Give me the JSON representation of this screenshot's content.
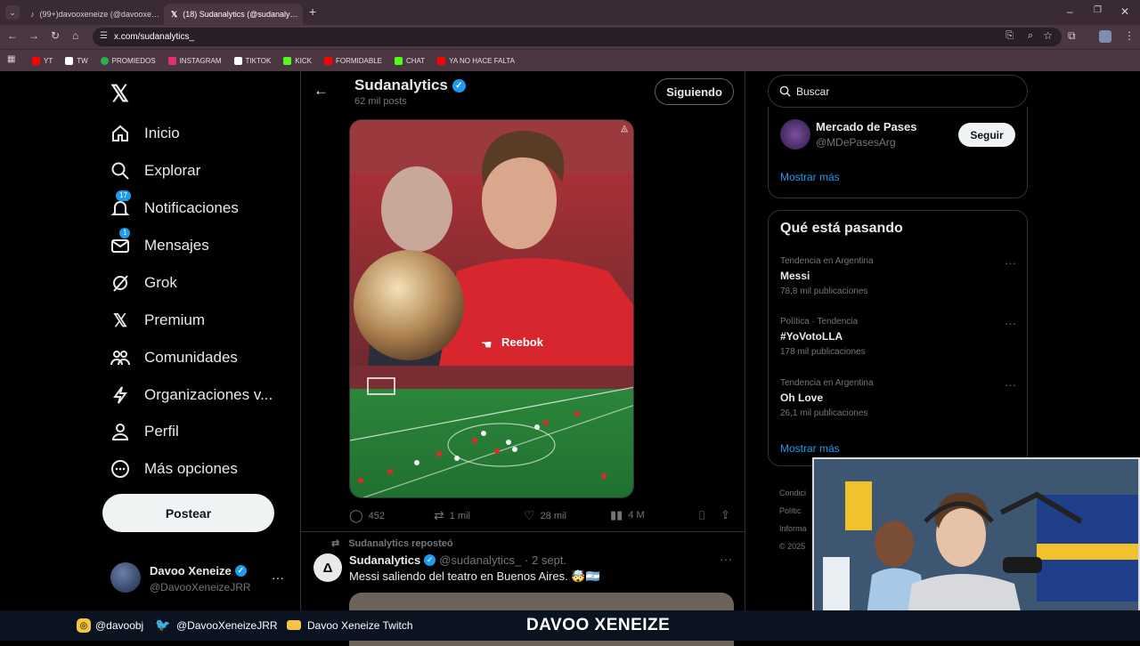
{
  "browser": {
    "tabs": [
      {
        "title": "(99+)davooxeneize (@davooxe…",
        "active": false
      },
      {
        "title": "(18) Sudanalytics (@sudanaly…",
        "active": true
      }
    ],
    "url": "x.com/sudanalytics_",
    "bookmarks": [
      {
        "label": "YT",
        "color": "#ff0000"
      },
      {
        "label": "TW",
        "color": "#ffffff"
      },
      {
        "label": "PROMIEDOS",
        "color": "#2bb24c"
      },
      {
        "label": "INSTAGRAM",
        "color": "#e1306c"
      },
      {
        "label": "TIKTOK",
        "color": "#ffffff"
      },
      {
        "label": "KICK",
        "color": "#53fc18"
      },
      {
        "label": "FORMIDABLE",
        "color": "#ff0000"
      },
      {
        "label": "CHAT",
        "color": "#53fc18"
      },
      {
        "label": "YA NO HACE FALTA",
        "color": "#ff0000"
      }
    ]
  },
  "nav": {
    "items": [
      {
        "label": "Inicio",
        "icon": "home-icon",
        "badge": ""
      },
      {
        "label": "Explorar",
        "icon": "search-icon",
        "badge": ""
      },
      {
        "label": "Notificaciones",
        "icon": "bell-icon",
        "badge": "17"
      },
      {
        "label": "Mensajes",
        "icon": "mail-icon",
        "badge": "1"
      },
      {
        "label": "Grok",
        "icon": "grok-icon",
        "badge": ""
      },
      {
        "label": "Premium",
        "icon": "x-icon",
        "badge": ""
      },
      {
        "label": "Comunidades",
        "icon": "people-icon",
        "badge": ""
      },
      {
        "label": "Organizaciones v...",
        "icon": "bolt-icon",
        "badge": ""
      },
      {
        "label": "Perfil",
        "icon": "person-icon",
        "badge": ""
      },
      {
        "label": "Más opciones",
        "icon": "more-icon",
        "badge": ""
      }
    ],
    "post_label": "Postear",
    "account_name": "Davoo Xeneize",
    "account_handle": "@DavooXeneizeJRR"
  },
  "profile": {
    "name": "Sudanalytics",
    "posts": "62 mil posts",
    "follow_label": "Siguiendo"
  },
  "tweet1": {
    "replies": "452",
    "retweets": "1 mil",
    "likes": "28 mil",
    "views": "4 M",
    "shirt_text": "Reebok"
  },
  "tweet2": {
    "repost_label": "Sudanalytics reposteó",
    "name": "Sudanalytics",
    "handle": "@sudanalytics_",
    "date": "· 2 sept.",
    "text": "Messi saliendo del teatro en Buenos Aires. 🤯🇦🇷"
  },
  "search": {
    "placeholder": "Buscar"
  },
  "suggest": {
    "name": "Mercado de Pases",
    "handle": "@MDePasesArg",
    "follow_label": "Seguir",
    "more_label": "Mostrar más"
  },
  "trends": {
    "title": "Qué está pasando",
    "items": [
      {
        "category": "Tendencia en Argentina",
        "name": "Messi",
        "count": "78,8 mil publicaciones"
      },
      {
        "category": "Política · Tendencia",
        "name": "#YoVotoLLA",
        "count": "178 mil publicaciones"
      },
      {
        "category": "Tendencia en Argentina",
        "name": "Oh Love",
        "count": "26,1 mil publicaciones"
      }
    ],
    "more_label": "Mostrar más"
  },
  "footer_links": [
    "Condici",
    "Polític",
    "Informa",
    "© 2025"
  ],
  "stream": {
    "instagram": "@davoobj",
    "twitter": "@DavooXeneizeJRR",
    "youtube": "Davoo Xeneize Twitch",
    "title": "DAVOO XENEIZE"
  }
}
